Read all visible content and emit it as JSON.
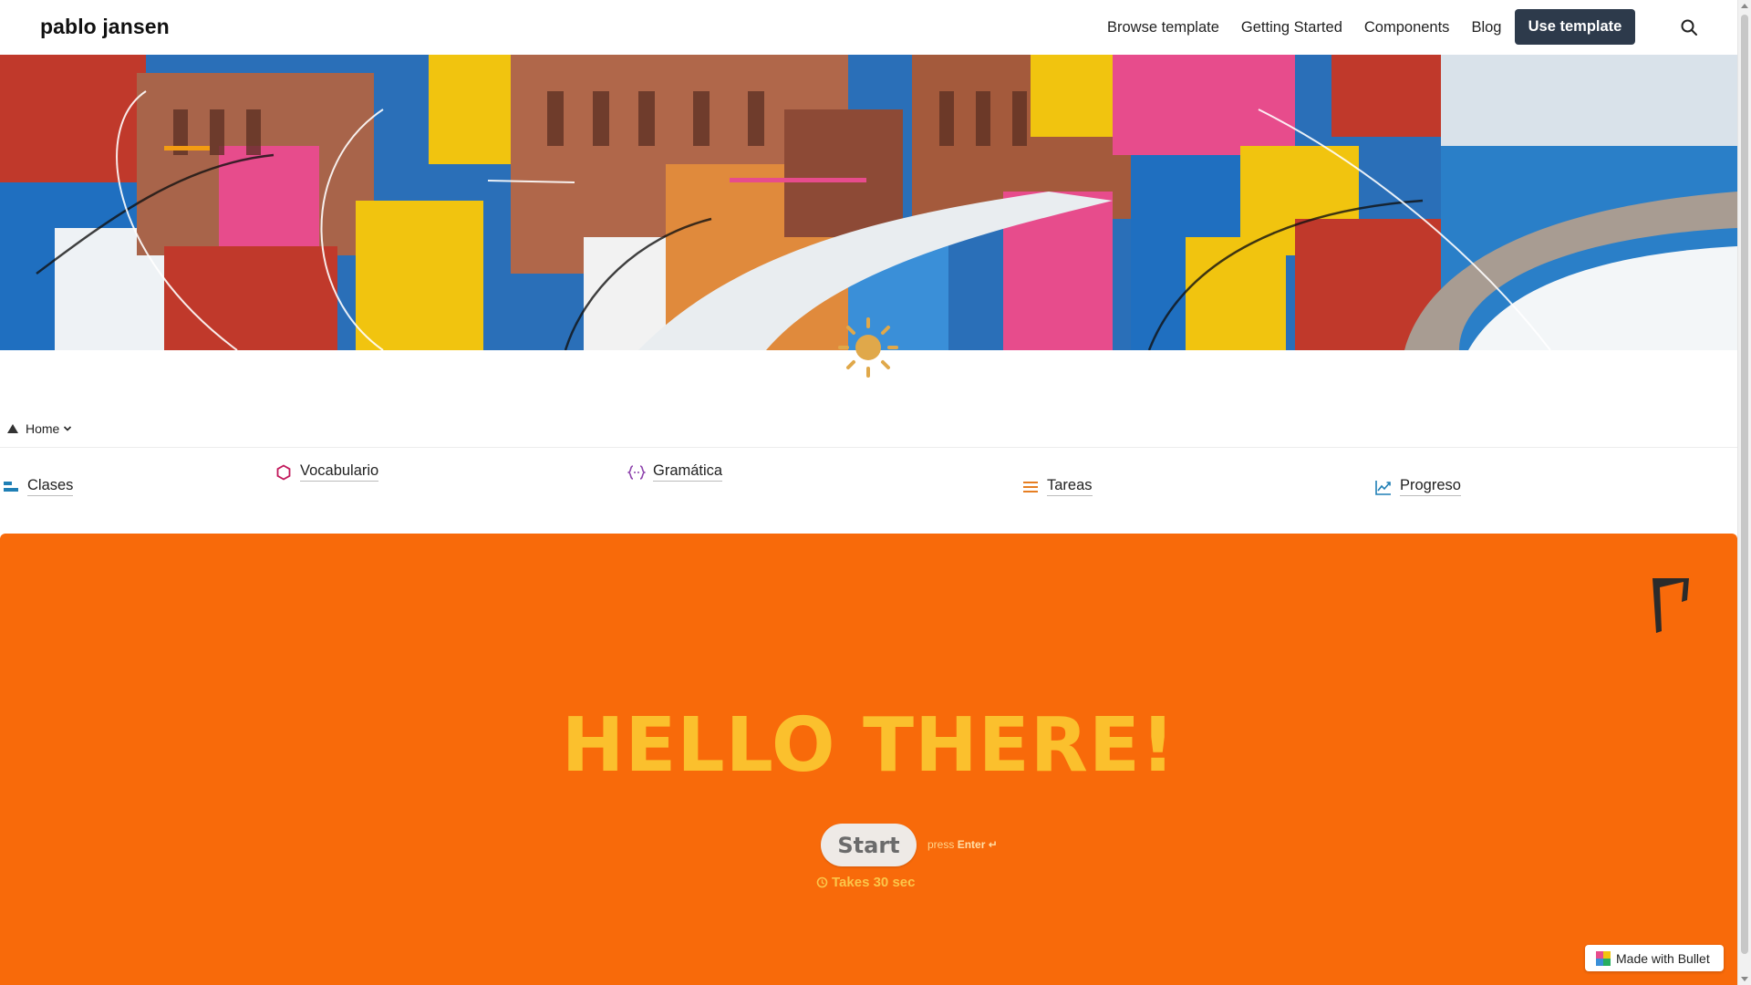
{
  "navbar": {
    "brand": "pablo jansen",
    "links": [
      "Browse template",
      "Getting Started",
      "Components",
      "Blog"
    ],
    "cta": "Use template",
    "cta_color": "#2d3a4b"
  },
  "breadcrumb": {
    "label": "Home"
  },
  "quick_links": [
    {
      "label": "Clases",
      "icon": "list-bars-icon",
      "color": "#1f7fb5"
    },
    {
      "label": "Vocabulario",
      "icon": "hexagon-icon",
      "color": "#c2185b"
    },
    {
      "label": "Gramática",
      "icon": "braces-icon",
      "color": "#8e44ad"
    },
    {
      "label": "Tareas",
      "icon": "menu-lines-icon",
      "color": "#e67e22"
    },
    {
      "label": "Progreso",
      "icon": "trending-up-icon",
      "color": "#1f7fb5"
    }
  ],
  "form": {
    "background": "#f86a0a",
    "headline": "HELLO THERE!",
    "headline_color": "#fbc02d",
    "start_label": "Start",
    "press_prefix": "press",
    "press_key": "Enter ↵",
    "takes": "Takes 30 sec"
  },
  "badge": {
    "label": "Made with Bullet"
  }
}
